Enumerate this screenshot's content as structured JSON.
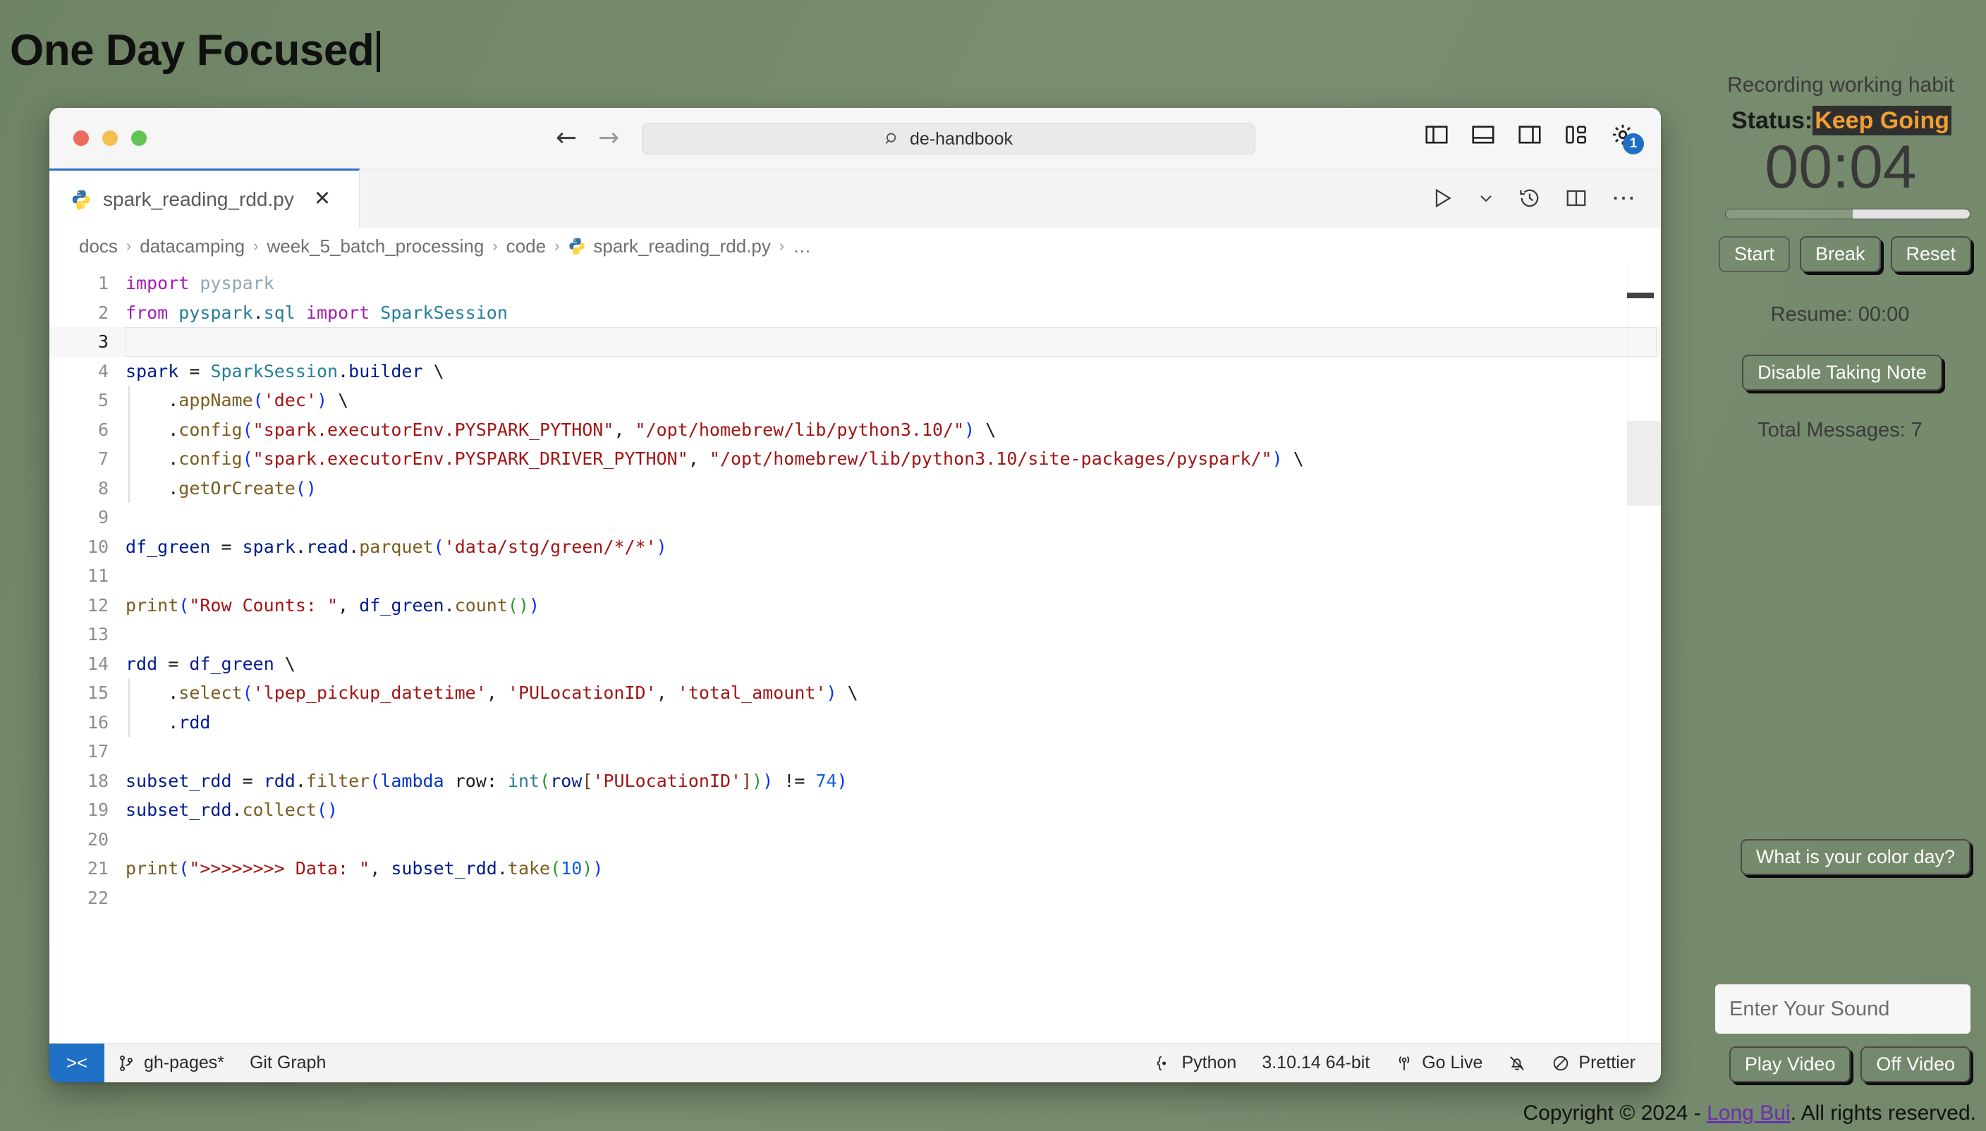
{
  "page": {
    "title": "One Day Focused",
    "background_color": "#74886b"
  },
  "window": {
    "titlebar": {
      "back_icon": "arrow-left-icon",
      "forward_icon": "arrow-right-icon",
      "search": {
        "icon": "search-icon",
        "value": "de-handbook"
      },
      "layout_icons": [
        "toggle-primary-sidebar-icon",
        "toggle-panel-icon",
        "toggle-secondary-sidebar-icon",
        "customize-layout-icon",
        "gear-icon"
      ],
      "gear_badge": "1",
      "badge_color": "#1f6fc4"
    },
    "tab": {
      "icon": "python-file-icon",
      "label": "spark_reading_rdd.py",
      "close_icon": "close-icon",
      "active_border_color": "#2f6fd0"
    },
    "tab_actions": [
      "run-python-file-icon",
      "chevron-down-icon",
      "timeline-history-icon",
      "split-editor-right-icon",
      "more-actions-icon"
    ],
    "breadcrumb": {
      "items": [
        "docs",
        "datacamping",
        "week_5_batch_processing",
        "code",
        "spark_reading_rdd.py"
      ],
      "trailing": "…",
      "separator": "›",
      "file_icon": "python-file-icon"
    },
    "statusbar": {
      "remote_icon": "remote-window-icon",
      "branch_icon": "source-control-branch-icon",
      "branch": "gh-pages*",
      "git_graph": "Git Graph",
      "language_icon": "json-braces-icon",
      "language": "Python",
      "interpreter": "3.10.14 64-bit",
      "golive_icon": "broadcast-icon",
      "golive": "Go Live",
      "bell_icon": "bell-slash-icon",
      "prettier_icon": "circle-slash-icon",
      "prettier": "Prettier"
    }
  },
  "code": {
    "current_line": 3,
    "lines": [
      {
        "n": 1,
        "html": "<span class=\"kw\">import</span> <span class=\"mod\">pyspark</span>"
      },
      {
        "n": 2,
        "html": "<span class=\"kw\">from</span> <span class=\"type\">pyspark</span><span class=\"op\">.</span><span class=\"type\">sql</span> <span class=\"kw\">import</span> <span class=\"type\">SparkSession</span>"
      },
      {
        "n": 3,
        "html": ""
      },
      {
        "n": 4,
        "html": "<span class=\"var\">spark</span> <span class=\"op\">=</span> <span class=\"type\">SparkSession</span><span class=\"op\">.</span><span class=\"var\">builder</span> <span class=\"op\">\\</span>"
      },
      {
        "n": 5,
        "html": "    <span class=\"op\">.</span><span class=\"fn\">appName</span><span class=\"p1\">(</span><span class=\"str\">'dec'</span><span class=\"p1\">)</span> <span class=\"op\">\\</span>"
      },
      {
        "n": 6,
        "html": "    <span class=\"op\">.</span><span class=\"fn\">config</span><span class=\"p1\">(</span><span class=\"str\">\"spark.executorEnv.PYSPARK_PYTHON\"</span><span class=\"op\">,</span> <span class=\"str\">\"/opt/homebrew/lib/python3.10/\"</span><span class=\"p1\">)</span> <span class=\"op\">\\</span>"
      },
      {
        "n": 7,
        "html": "    <span class=\"op\">.</span><span class=\"fn\">config</span><span class=\"p1\">(</span><span class=\"str\">\"spark.executorEnv.PYSPARK_DRIVER_PYTHON\"</span><span class=\"op\">,</span> <span class=\"str\">\"/opt/homebrew/lib/python3.10/site-packages/pyspark/\"</span><span class=\"p1\">)</span> <span class=\"op\">\\</span>"
      },
      {
        "n": 8,
        "html": "    <span class=\"op\">.</span><span class=\"fn\">getOrCreate</span><span class=\"p1\">()</span>"
      },
      {
        "n": 9,
        "html": ""
      },
      {
        "n": 10,
        "html": "<span class=\"var\">df_green</span> <span class=\"op\">=</span> <span class=\"var\">spark</span><span class=\"op\">.</span><span class=\"var\">read</span><span class=\"op\">.</span><span class=\"fn\">parquet</span><span class=\"p1\">(</span><span class=\"str\">'data/stg/green/*/*'</span><span class=\"p1\">)</span>"
      },
      {
        "n": 11,
        "html": ""
      },
      {
        "n": 12,
        "html": "<span class=\"fn\">print</span><span class=\"p1\">(</span><span class=\"str\">\"Row Counts: \"</span><span class=\"op\">,</span> <span class=\"var\">df_green</span><span class=\"op\">.</span><span class=\"fn\">count</span><span class=\"p2\">()</span><span class=\"p1\">)</span>"
      },
      {
        "n": 13,
        "html": ""
      },
      {
        "n": 14,
        "html": "<span class=\"var\">rdd</span> <span class=\"op\">=</span> <span class=\"var\">df_green</span> <span class=\"op\">\\</span>"
      },
      {
        "n": 15,
        "html": "    <span class=\"op\">.</span><span class=\"fn\">select</span><span class=\"p1\">(</span><span class=\"str\">'lpep_pickup_datetime'</span><span class=\"op\">,</span> <span class=\"str\">'PULocationID'</span><span class=\"op\">,</span> <span class=\"str\">'total_amount'</span><span class=\"p1\">)</span> <span class=\"op\">\\</span>"
      },
      {
        "n": 16,
        "html": "    <span class=\"op\">.</span><span class=\"var\">rdd</span>"
      },
      {
        "n": 17,
        "html": ""
      },
      {
        "n": 18,
        "html": "<span class=\"var\">subset_rdd</span> <span class=\"op\">=</span> <span class=\"var\">rdd</span><span class=\"op\">.</span><span class=\"fn\">filter</span><span class=\"p1\">(</span><span class=\"kw2\">lambda</span> <span class=\"op\">row:</span> <span class=\"type\">int</span><span class=\"p2\">(</span><span class=\"var\">row</span><span class=\"p3\">[</span><span class=\"str\">'PULocationID'</span><span class=\"p3\">]</span><span class=\"p2\">)</span><span class=\"p1\">)</span> <span class=\"op\">!=</span> <span class=\"num\">74</span><span class=\"p1\">)</span>"
      },
      {
        "n": 19,
        "html": "<span class=\"var\">subset_rdd</span><span class=\"op\">.</span><span class=\"fn\">collect</span><span class=\"p1\">()</span>"
      },
      {
        "n": 20,
        "html": ""
      },
      {
        "n": 21,
        "html": "<span class=\"fn\">print</span><span class=\"p1\">(</span><span class=\"str\">\"&gt;&gt;&gt;&gt;&gt;&gt;&gt;&gt; Data: \"</span><span class=\"op\">,</span> <span class=\"var\">subset_rdd</span><span class=\"op\">.</span><span class=\"fn\">take</span><span class=\"p2\">(</span><span class=\"num\">10</span><span class=\"p2\">)</span><span class=\"p1\">)</span>"
      },
      {
        "n": 22,
        "html": ""
      }
    ]
  },
  "focus_panel": {
    "heading": "Recording working habit",
    "status_label": "Status:",
    "status_value": "Keep Going",
    "status_value_color": "#f0a030",
    "status_bg_color": "#2f2f2f",
    "timer": "00:04",
    "progress_percent": 52,
    "buttons": [
      "Start",
      "Break",
      "Reset"
    ],
    "resume": "Resume: 00:00",
    "note_button": "Disable Taking Note",
    "total_messages": "Total Messages: 7",
    "color_day_button": "What is your color day?",
    "sound_placeholder": "Enter Your Sound",
    "sound_value": "",
    "play_video_button": "Play Video",
    "off_video_button": "Off Video"
  },
  "footer": {
    "prefix": "Copyright © 2024 - ",
    "link": "Long Bui",
    "suffix": ". All rights reserved.",
    "link_color": "#6b2fb5"
  }
}
